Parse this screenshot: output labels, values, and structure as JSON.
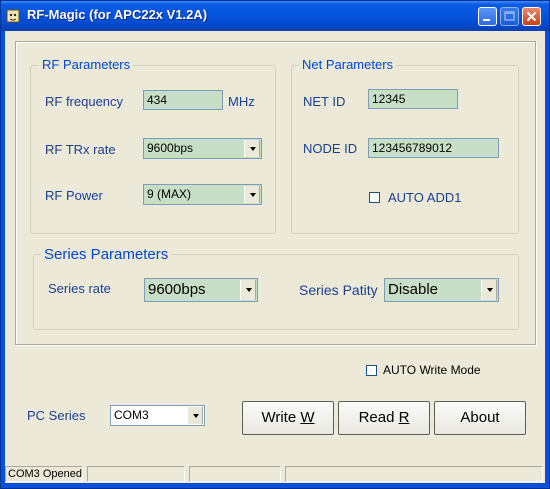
{
  "window": {
    "title": "RF-Magic (for APC22x V1.2A)",
    "app_icon": "dog-icon"
  },
  "rf_parameters": {
    "legend": "RF Parameters",
    "frequency_label": "RF frequency",
    "frequency_value": "434",
    "frequency_unit": "MHz",
    "trx_rate_label": "RF TRx rate",
    "trx_rate_value": "9600bps",
    "power_label": "RF Power",
    "power_value": "9 (MAX)"
  },
  "net_parameters": {
    "legend": "Net Parameters",
    "net_id_label": "NET ID",
    "net_id_value": "12345",
    "node_id_label": "NODE ID",
    "node_id_value": "123456789012",
    "auto_add_label": "AUTO ADD1",
    "auto_add_checked": false
  },
  "series_parameters": {
    "legend": "Series Parameters",
    "rate_label": "Series rate",
    "rate_value": "9600bps",
    "parity_label": "Series Patity",
    "parity_value": "Disable"
  },
  "auto_write": {
    "label": "AUTO Write Mode",
    "checked": false
  },
  "pc_series": {
    "label": "PC Series",
    "value": "COM3"
  },
  "buttons": {
    "write_prefix": "Write ",
    "write_accel": "W",
    "read_prefix": "Read ",
    "read_accel": "R",
    "about": "About"
  },
  "status_bar": {
    "panes": [
      "COM3 Opened",
      "",
      "",
      ""
    ]
  }
}
